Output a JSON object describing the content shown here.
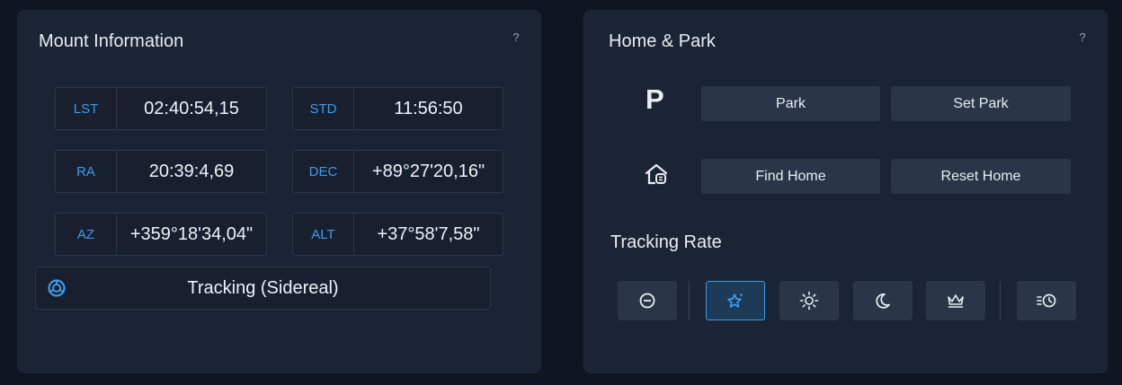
{
  "mount_info": {
    "title": "Mount Information",
    "help": "?",
    "fields": [
      {
        "label": "LST",
        "value": "02:40:54,15"
      },
      {
        "label": "STD",
        "value": "11:56:50"
      },
      {
        "label": "RA",
        "value": "20:39:4,69"
      },
      {
        "label": "DEC",
        "value": "+89°27'20,16\""
      },
      {
        "label": "AZ",
        "value": "+359°18'34,04\""
      },
      {
        "label": "ALT",
        "value": "+37°58'7,58\""
      }
    ],
    "tracking_status": "Tracking (Sidereal)",
    "tracking_icon": "tracking-target-icon"
  },
  "home_park": {
    "title": "Home & Park",
    "help": "?",
    "park_glyph": "P",
    "park_button": "Park",
    "set_park_button": "Set Park",
    "find_home_button": "Find Home",
    "reset_home_button": "Reset Home",
    "home_icon": "home-icon"
  },
  "tracking_rate": {
    "title": "Tracking Rate",
    "selected": "sidereal",
    "buttons": [
      {
        "name": "stop",
        "icon": "stop-icon"
      },
      {
        "name": "sidereal",
        "icon": "star-icon"
      },
      {
        "name": "solar",
        "icon": "sun-icon"
      },
      {
        "name": "lunar",
        "icon": "moon-icon"
      },
      {
        "name": "king",
        "icon": "crown-icon"
      },
      {
        "name": "custom",
        "icon": "custom-rate-icon"
      }
    ]
  },
  "colors": {
    "accent": "#3d9be9",
    "panel_bg": "#1b2434",
    "button_bg": "#2a3547",
    "text": "#e8edf3"
  }
}
